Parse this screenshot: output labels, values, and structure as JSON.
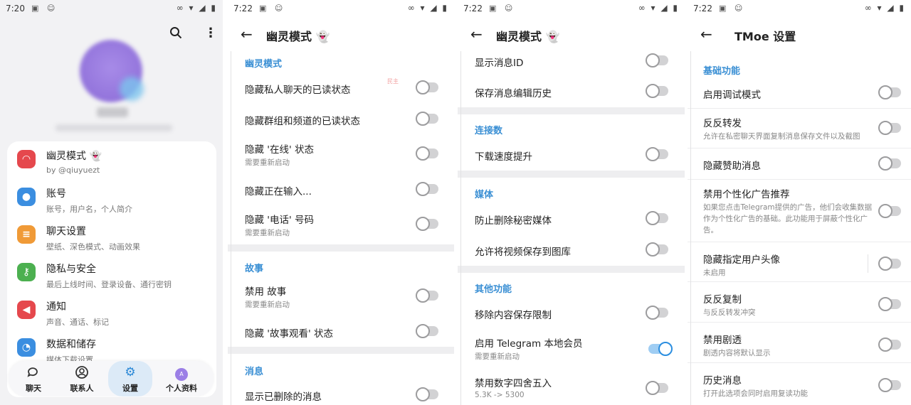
{
  "panel1": {
    "status_time": "7:20",
    "menu": [
      {
        "title": "幽灵模式 👻",
        "sub": "by @qiuyuezt",
        "icon": "ghost-icon",
        "color": "#e5484d"
      },
      {
        "title": "账号",
        "sub": "账号，用户名，个人简介",
        "icon": "person-icon",
        "color": "#3b8ee0"
      },
      {
        "title": "聊天设置",
        "sub": "壁纸、深色模式、动画效果",
        "icon": "chat-icon",
        "color": "#f09a37"
      },
      {
        "title": "隐私与安全",
        "sub": "最后上线时间、登录设备、通行密钥",
        "icon": "key-icon",
        "color": "#4cb050"
      },
      {
        "title": "通知",
        "sub": "声音、通话、标记",
        "icon": "speaker-icon",
        "color": "#e5484d"
      },
      {
        "title": "数据和储存",
        "sub": "媒体下载设置",
        "icon": "data-icon",
        "color": "#3b8ee0"
      }
    ],
    "nav": [
      {
        "label": "聊天",
        "icon": "chats-icon"
      },
      {
        "label": "联系人",
        "icon": "contacts-icon"
      },
      {
        "label": "设置",
        "icon": "settings-icon"
      },
      {
        "label": "个人资料",
        "icon": "profile-avatar-icon"
      }
    ],
    "avatar_letter": "A"
  },
  "panel2": {
    "status_time": "7:22",
    "title": "幽灵模式 👻",
    "sections": [
      {
        "header": "幽灵模式",
        "rows": [
          {
            "title": "隐藏私人聊天的已读状态",
            "sub": "",
            "on": false
          },
          {
            "title": "隐藏群组和频道的已读状态",
            "sub": "",
            "on": false
          },
          {
            "title": "隐藏 '在线' 状态",
            "sub": "需要重新启动",
            "on": false
          },
          {
            "title": "隐藏正在输入...",
            "sub": "",
            "on": false
          },
          {
            "title": "隐藏 '电话' 号码",
            "sub": "需要重新启动",
            "on": false
          }
        ]
      },
      {
        "header": "故事",
        "rows": [
          {
            "title": "禁用 故事",
            "sub": "需要重新启动",
            "on": false
          },
          {
            "title": "隐藏 '故事观看' 状态",
            "sub": "",
            "on": false
          }
        ]
      },
      {
        "header": "消息",
        "rows": [
          {
            "title": "显示已删除的消息",
            "sub": "",
            "on": false
          }
        ]
      }
    ]
  },
  "panel3": {
    "status_time": "7:22",
    "title": "幽灵模式 👻",
    "rows_top": [
      {
        "title": "显示消息ID",
        "sub": "",
        "on": false
      },
      {
        "title": "保存消息编辑历史",
        "sub": "",
        "on": false
      }
    ],
    "sections": [
      {
        "header": "连接数",
        "rows": [
          {
            "title": "下载速度提升",
            "sub": "",
            "on": false
          }
        ]
      },
      {
        "header": "媒体",
        "rows": [
          {
            "title": "防止删除秘密媒体",
            "sub": "",
            "on": false
          },
          {
            "title": "允许将视频保存到图库",
            "sub": "",
            "on": false
          }
        ]
      },
      {
        "header": "其他功能",
        "rows": [
          {
            "title": "移除内容保存限制",
            "sub": "",
            "on": false
          },
          {
            "title": "启用 Telegram 本地会员",
            "sub": "需要重新启动",
            "on": true
          },
          {
            "title": "禁用数字四舍五入",
            "sub": "5.3K -> 5300",
            "on": false
          }
        ]
      }
    ]
  },
  "panel4": {
    "status_time": "7:22",
    "title": "TMoe 设置",
    "section": "基础功能",
    "rows": [
      {
        "title": "启用调试模式",
        "sub": "",
        "on": false
      },
      {
        "title": "反反转发",
        "sub": "允许在私密聊天界面复制消息保存文件以及截图",
        "on": false
      },
      {
        "title": "隐藏赞助消息",
        "sub": "",
        "on": false
      },
      {
        "title": "禁用个性化广告推荐",
        "sub": "如果您点击Telegram提供的广告，他们会收集数据作为个性化广告的基础。此功能用于屏蔽个性化广告。",
        "on": false
      },
      {
        "title": "隐藏指定用户头像",
        "sub": "未启用",
        "on": false
      },
      {
        "title": "反反复制",
        "sub": "与反反转发冲突",
        "on": false
      },
      {
        "title": "禁用剧透",
        "sub": "剧透内容将默认显示",
        "on": false
      },
      {
        "title": "历史消息",
        "sub": "打开此选项会同时启用复读功能",
        "on": false
      }
    ]
  }
}
